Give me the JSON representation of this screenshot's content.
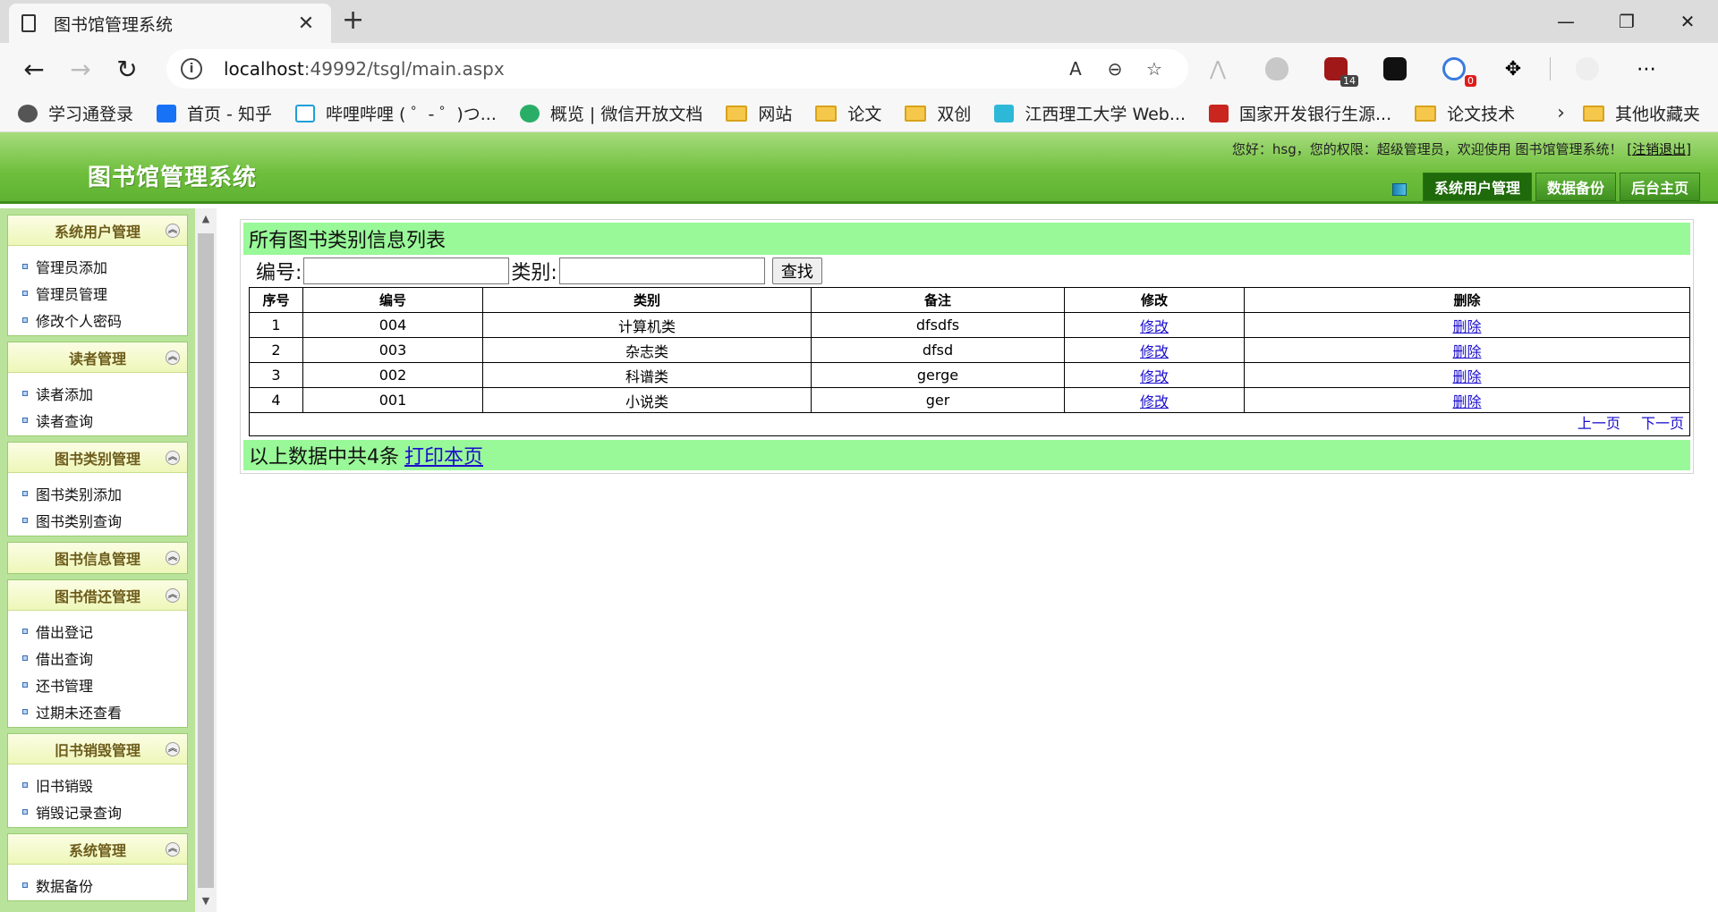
{
  "browser": {
    "tab_title": "图书馆管理系统",
    "url_host": "localhost",
    "url_path": ":49992/tsgl/main.aspx",
    "ext_badges": [
      "14",
      "0"
    ],
    "bookmarks": [
      "学习通登录",
      "首页 - 知乎",
      "哔哩哔哩 ( ゜- ゜)つ...",
      "概览 | 微信开放文档",
      "网站",
      "论文",
      "双创",
      "江西理工大学 Web...",
      "国家开发银行生源...",
      "论文技术"
    ],
    "other_bookmarks": "其他收藏夹"
  },
  "header": {
    "title": "图书馆管理系统",
    "welcome": "您好：hsg，您的权限：超级管理员，欢迎使用 图书馆管理系统！",
    "logout": "[注销退出]",
    "nav": [
      "系统用户管理",
      "数据备份",
      "后台主页"
    ]
  },
  "sidebar": {
    "groups": [
      {
        "title": "系统用户管理",
        "items": [
          "管理员添加",
          "管理员管理",
          "修改个人密码"
        ]
      },
      {
        "title": "读者管理",
        "items": [
          "读者添加",
          "读者查询"
        ]
      },
      {
        "title": "图书类别管理",
        "items": [
          "图书类别添加",
          "图书类别查询"
        ]
      },
      {
        "title": "图书信息管理",
        "items": []
      },
      {
        "title": "图书借还管理",
        "items": [
          "借出登记",
          "借出查询",
          "还书管理",
          "过期未还查看"
        ]
      },
      {
        "title": "旧书销毁管理",
        "items": [
          "旧书销毁",
          "销毁记录查询"
        ]
      },
      {
        "title": "系统管理",
        "items": [
          "数据备份"
        ]
      }
    ]
  },
  "content": {
    "title": "所有图书类别信息列表",
    "search_no_label": "编号:",
    "search_cat_label": "类别:",
    "search_button": "查找",
    "columns": [
      "序号",
      "编号",
      "类别",
      "备注",
      "修改",
      "删除"
    ],
    "rows": [
      [
        "1",
        "004",
        "计算机类",
        "dfsdfs",
        "修改",
        "删除"
      ],
      [
        "2",
        "003",
        "杂志类",
        "dfsd",
        "修改",
        "删除"
      ],
      [
        "3",
        "002",
        "科谱类",
        "gerge",
        "修改",
        "删除"
      ],
      [
        "4",
        "001",
        "小说类",
        "ger",
        "修改",
        "删除"
      ]
    ],
    "prev_page": "上一页",
    "next_page": "下一页",
    "footer_text": "以上数据中共4条",
    "print_link": "打印本页"
  }
}
